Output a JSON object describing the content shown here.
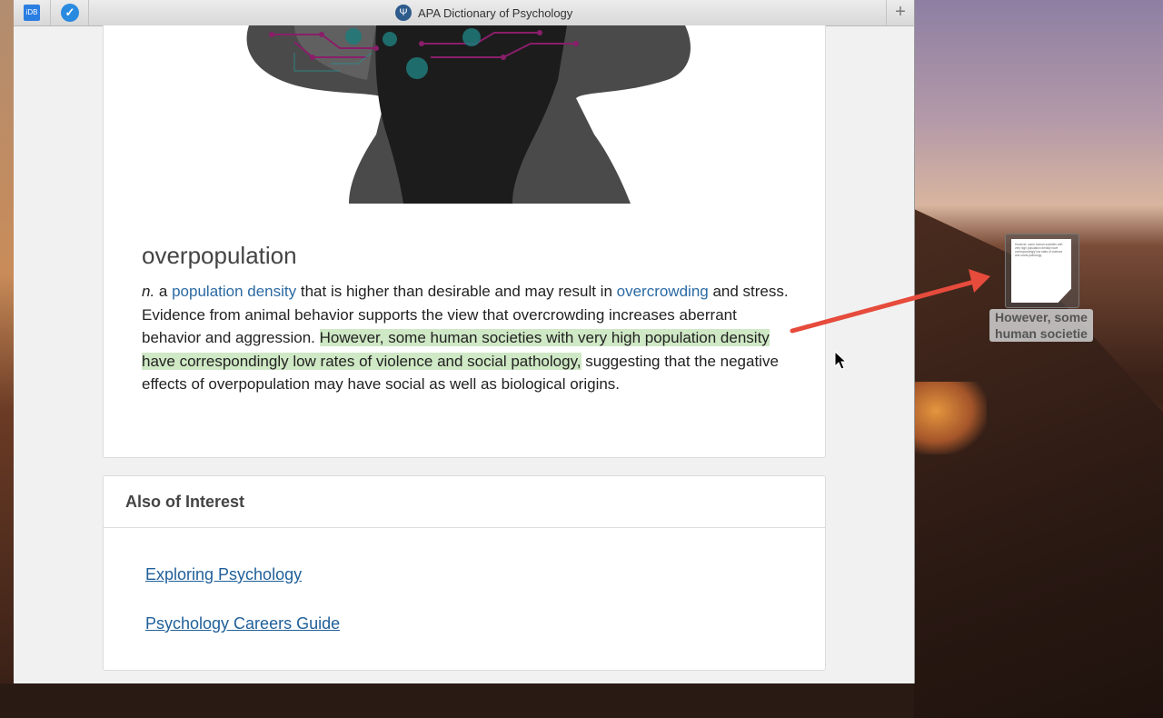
{
  "window": {
    "title": "APA Dictionary of Psychology",
    "tab_idb_label": "iDB",
    "plus_label": "+"
  },
  "entry": {
    "headword": "overpopulation",
    "pos": "n.",
    "pre_text": " a ",
    "link1": "population density",
    "mid_text1": " that is higher than desirable and may result in ",
    "link2": "overcrowding",
    "mid_text2": " and stress. Evidence from animal behavior supports the view that overcrowding increases aberrant behavior and aggression. ",
    "highlighted": "However, some human societies with very high population density have correspondingly low rates of violence and social pathology,",
    "post_text": " suggesting that the negative effects of overpopulation may have social as well as biological origins."
  },
  "also_of_interest": {
    "title": "Also of Interest",
    "links": [
      "Exploring Psychology",
      "Psychology Careers Guide"
    ]
  },
  "drag_clip": {
    "label": "However, some human societie",
    "preview_text": "However, some human societies with very high population density have correspondingly low rates of violence and social pathology,"
  },
  "colors": {
    "link": "#2b6aa3",
    "highlight": "#cfe8c5",
    "arrow": "#e64b3c"
  }
}
